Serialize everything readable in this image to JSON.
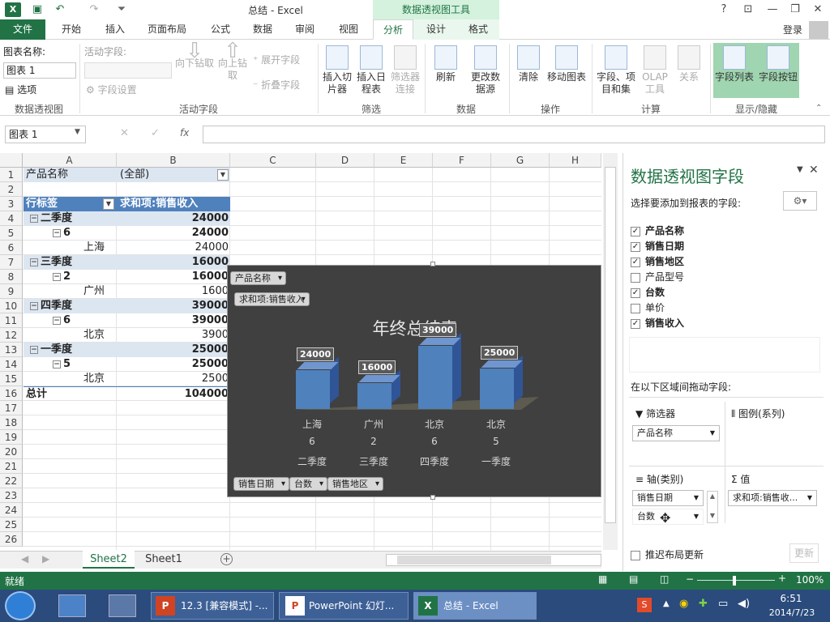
{
  "window": {
    "title": "总结 - Excel",
    "context_tab_group": "数据透视图工具",
    "login": "登录"
  },
  "tabs": [
    "文件",
    "开始",
    "插入",
    "页面布局",
    "公式",
    "数据",
    "审阅",
    "视图",
    "分析",
    "设计",
    "格式"
  ],
  "ribbon": {
    "chart_name_label": "图表名称:",
    "chart_name_value": "图表 1",
    "options": "选项",
    "group_pivotchart": "数据透视图",
    "active_field_label": "活动字段:",
    "field_settings": "字段设置",
    "drill_down": "向下钻取",
    "drill_up": "向上钻取",
    "expand_field": "展开字段",
    "collapse_field": "折叠字段",
    "group_active_field": "活动字段",
    "insert_slicer": "插入切片器",
    "insert_timeline": "插入日程表",
    "filter_connections": "筛选器连接",
    "group_filter": "筛选",
    "refresh": "刷新",
    "change_source": "更改数据源",
    "group_data": "数据",
    "clear": "清除",
    "move_chart": "移动图表",
    "group_actions": "操作",
    "fields_items": "字段、项目和集",
    "olap_tools": "OLAP 工具",
    "relationships": "关系",
    "group_calc": "计算",
    "field_list": "字段列表",
    "field_buttons": "字段按钮",
    "group_show": "显示/隐藏"
  },
  "formula_bar": {
    "name_box": "图表 1",
    "fx": "fx"
  },
  "columns": [
    "A",
    "B",
    "C",
    "D",
    "E",
    "F",
    "G",
    "H"
  ],
  "rows": [
    "1",
    "2",
    "3",
    "4",
    "5",
    "6",
    "7",
    "8",
    "9",
    "10",
    "11",
    "12",
    "13",
    "14",
    "15",
    "16",
    "17",
    "18",
    "19",
    "20",
    "21",
    "22",
    "23",
    "24",
    "25",
    "26"
  ],
  "pivot": {
    "filter_label": "产品名称",
    "filter_value": "(全部)",
    "row_header": "行标签",
    "value_header": "求和项:销售收入",
    "rows": [
      {
        "label": "二季度",
        "value": "24000",
        "level": 0
      },
      {
        "label": "6",
        "value": "24000",
        "level": 1
      },
      {
        "label": "上海",
        "value": "24000",
        "level": 2
      },
      {
        "label": "三季度",
        "value": "16000",
        "level": 0
      },
      {
        "label": "2",
        "value": "16000",
        "level": 1
      },
      {
        "label": "广州",
        "value": "1600",
        "level": 2
      },
      {
        "label": "四季度",
        "value": "39000",
        "level": 0
      },
      {
        "label": "6",
        "value": "39000",
        "level": 1
      },
      {
        "label": "北京",
        "value": "3900",
        "level": 2
      },
      {
        "label": "一季度",
        "value": "25000",
        "level": 0
      },
      {
        "label": "5",
        "value": "25000",
        "level": 1
      },
      {
        "label": "北京",
        "value": "2500",
        "level": 2
      }
    ],
    "total_label": "总计",
    "total_value": "104000"
  },
  "chart_data": {
    "type": "bar",
    "title": "年终总结表",
    "filter_button": "产品名称",
    "value_button": "求和项:销售收入",
    "axis_buttons": [
      "销售日期",
      "台数",
      "销售地区"
    ],
    "categories": [
      [
        "上海",
        "6",
        "二季度"
      ],
      [
        "广州",
        "2",
        "三季度"
      ],
      [
        "北京",
        "6",
        "四季度"
      ],
      [
        "北京",
        "5",
        "一季度"
      ]
    ],
    "values": [
      24000,
      16000,
      39000,
      25000
    ],
    "labels": [
      "24000",
      "16000",
      "39000",
      "25000"
    ]
  },
  "sheet_tabs": [
    "Sheet2",
    "Sheet1"
  ],
  "pane": {
    "title": "数据透视图字段",
    "subtitle": "选择要添加到报表的字段:",
    "fields": [
      {
        "name": "产品名称",
        "checked": true
      },
      {
        "name": "销售日期",
        "checked": true
      },
      {
        "name": "销售地区",
        "checked": true
      },
      {
        "name": "产品型号",
        "checked": false
      },
      {
        "name": "台数",
        "checked": true
      },
      {
        "name": "单价",
        "checked": false
      },
      {
        "name": "销售收入",
        "checked": true
      }
    ],
    "drag_hint": "在以下区域间拖动字段:",
    "filters_label": "筛选器",
    "filters_item": "产品名称",
    "legend_label": "图例(系列)",
    "axis_label": "轴(类别)",
    "axis_items": [
      "销售日期",
      "台数"
    ],
    "values_label": "值",
    "values_item": "求和项:销售收...",
    "defer": "推迟布局更新",
    "update": "更新"
  },
  "status": {
    "ready": "就绪",
    "zoom": "100%"
  },
  "taskbar": {
    "items": [
      "12.3 [兼容模式] -...",
      "PowerPoint 幻灯...",
      "总结 - Excel"
    ],
    "time": "6:51",
    "date": "2014/7/23"
  }
}
